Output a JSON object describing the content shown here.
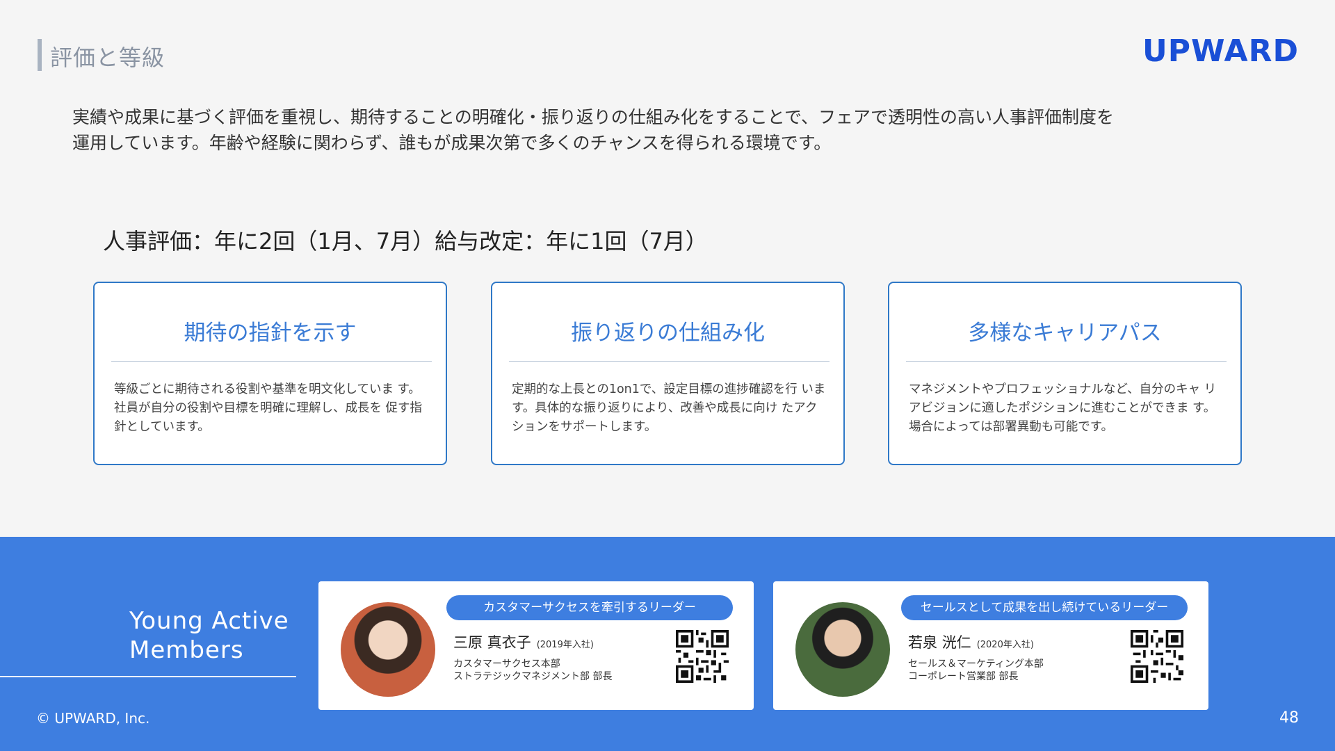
{
  "header": {
    "section_title": "評価と等級",
    "logo": "UPWARD"
  },
  "intro": {
    "line1": "実績や成果に基づく評価を重視し、期待することの明確化・振り返りの仕組み化をすることで、フェアで透明性の高い人事評価制度を",
    "line2": "運用しています。年齢や経験に関わらず、誰もが成果次第で多くのチャンスを得られる環境です。"
  },
  "policy": "人事評価：年に2回（1月、7月）給与改定：年に1回（7月）",
  "cards": [
    {
      "title": "期待の指針を示す",
      "text": "等級ごとに期待される役割や基準を明文化していま す。社員が自分の役割や目標を明確に理解し、成長を 促す指針としています。"
    },
    {
      "title": "振り返りの仕組み化",
      "text": "定期的な上長との1on1で、設定目標の進捗確認を行 います。具体的な振り返りにより、改善や成長に向け たアクションをサポートします。"
    },
    {
      "title": "多様なキャリアパス",
      "text": "マネジメントやプロフェッショナルなど、自分のキャ リアビジョンに適したポジションに進むことができま す。場合によっては部署異動も可能です。"
    }
  ],
  "members_section": {
    "title_line1": "Young Active",
    "title_line2": "Members"
  },
  "members": [
    {
      "tagline": "カスタマーサクセスを牽引するリーダー",
      "name": "三原 真衣子",
      "joined": "(2019年入社)",
      "dept1": "カスタマーサクセス本部",
      "dept2": "ストラテジックマネジメント部 部長"
    },
    {
      "tagline": "セールスとして成果を出し続けているリーダー",
      "name": "若泉 洸仁",
      "joined": "(2020年入社)",
      "dept1": "セールス＆マーケティング本部",
      "dept2": "コーポレート営業部 部長"
    }
  ],
  "footer": {
    "copyright": "© UPWARD, Inc.",
    "page_number": "48"
  },
  "colors": {
    "accent_blue": "#3e7ee0",
    "logo_blue": "#1a4fd6",
    "card_border": "#2f78c7"
  }
}
